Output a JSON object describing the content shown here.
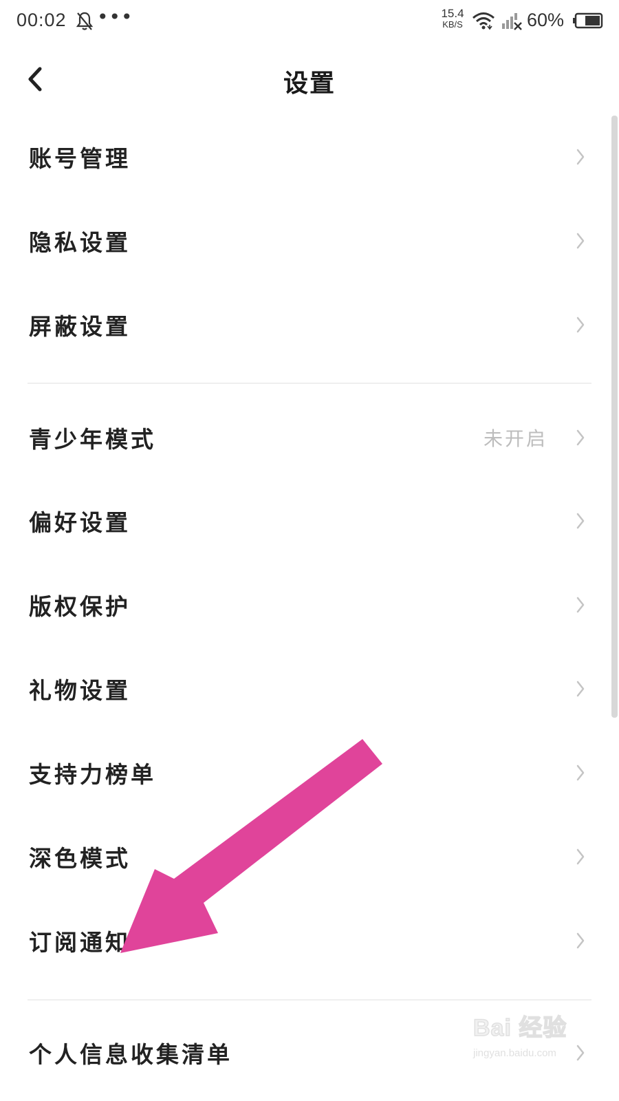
{
  "status_bar": {
    "time": "00:02",
    "dots": "•••",
    "speed_value": "15.4",
    "speed_unit": "KB/S",
    "battery": "60%"
  },
  "header": {
    "title": "设置",
    "back_icon": "chevron-left-icon"
  },
  "settings": {
    "items": [
      {
        "label": "账号管理",
        "value": ""
      },
      {
        "label": "隐私设置",
        "value": ""
      },
      {
        "label": "屏蔽设置",
        "value": ""
      },
      {
        "label": "青少年模式",
        "value": "未开启"
      },
      {
        "label": "偏好设置",
        "value": ""
      },
      {
        "label": "版权保护",
        "value": ""
      },
      {
        "label": "礼物设置",
        "value": ""
      },
      {
        "label": "支持力榜单",
        "value": ""
      },
      {
        "label": "深色模式",
        "value": ""
      },
      {
        "label": "订阅通知",
        "value": ""
      },
      {
        "label": "个人信息收集清单",
        "value": ""
      }
    ]
  },
  "annotation": {
    "arrow_color": "#e0449a"
  },
  "watermark": {
    "logo_text": "Bai 经验",
    "url": "jingyan.baidu.com"
  },
  "colors": {
    "text": "#222222",
    "secondary": "#bdbdbd",
    "chevron": "#c4c4c4",
    "divider": "#efefef"
  }
}
